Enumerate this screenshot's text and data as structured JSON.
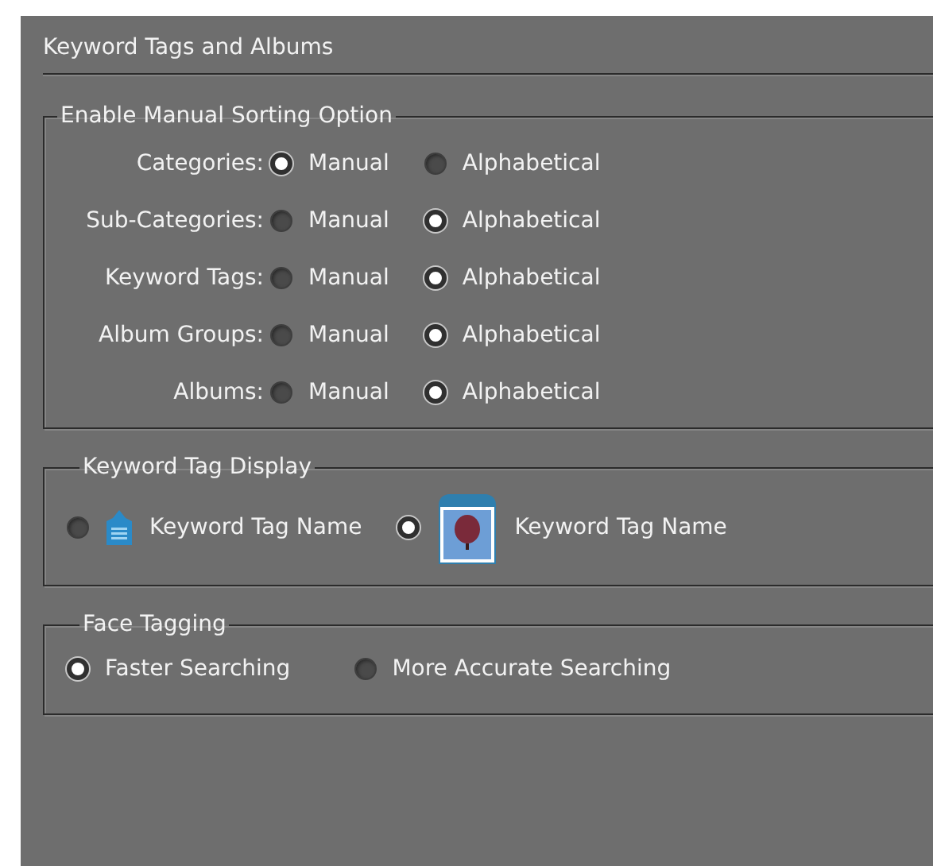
{
  "panel": {
    "title": "Keyword Tags and Albums"
  },
  "sorting": {
    "legend": "Enable Manual Sorting Option",
    "rows": [
      {
        "label": "Categories:",
        "options": [
          {
            "label": "Manual",
            "selected": true
          },
          {
            "label": "Alphabetical",
            "selected": false
          }
        ]
      },
      {
        "label": "Sub-Categories:",
        "options": [
          {
            "label": "Manual",
            "selected": false
          },
          {
            "label": "Alphabetical",
            "selected": true
          }
        ]
      },
      {
        "label": "Keyword Tags:",
        "options": [
          {
            "label": "Manual",
            "selected": false
          },
          {
            "label": "Alphabetical",
            "selected": true
          }
        ]
      },
      {
        "label": "Album Groups:",
        "options": [
          {
            "label": "Manual",
            "selected": false
          },
          {
            "label": "Alphabetical",
            "selected": true
          }
        ]
      },
      {
        "label": "Albums:",
        "options": [
          {
            "label": "Manual",
            "selected": false
          },
          {
            "label": "Alphabetical",
            "selected": true
          }
        ]
      }
    ]
  },
  "tag_display": {
    "legend": "Keyword Tag Display",
    "options": [
      {
        "kind": "tag",
        "label": "Keyword Tag Name",
        "selected": false
      },
      {
        "kind": "photo",
        "label": "Keyword Tag Name",
        "selected": true
      }
    ]
  },
  "face_tagging": {
    "legend": "Face Tagging",
    "options": [
      {
        "label": "Faster Searching",
        "selected": true
      },
      {
        "label": "More Accurate Searching",
        "selected": false
      }
    ]
  }
}
